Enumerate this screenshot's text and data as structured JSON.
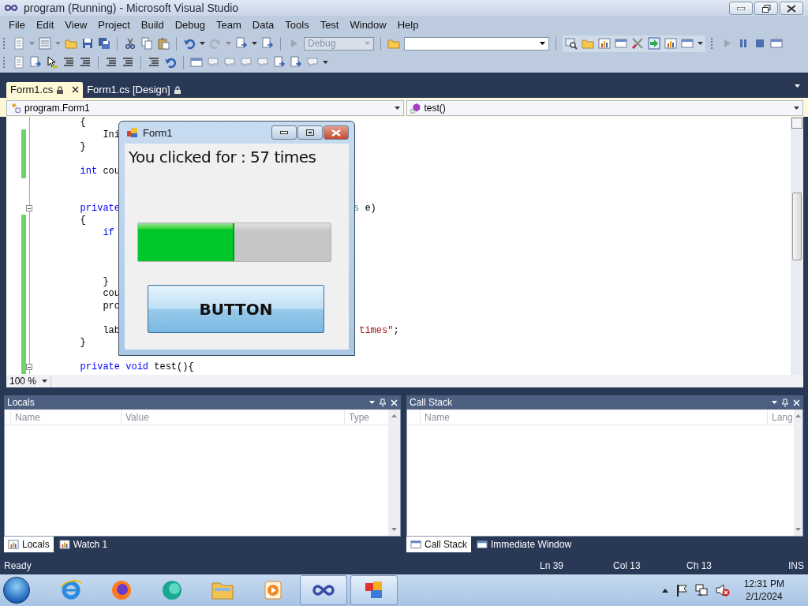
{
  "window": {
    "title": "program (Running) - Microsoft Visual Studio"
  },
  "menu": [
    "File",
    "Edit",
    "View",
    "Project",
    "Build",
    "Debug",
    "Team",
    "Data",
    "Tools",
    "Test",
    "Window",
    "Help"
  ],
  "toolbar": {
    "configuration": {
      "value": "Debug",
      "disabled": true
    }
  },
  "document_tabs": [
    {
      "label": "Form1.cs",
      "selected": true,
      "locked": true
    },
    {
      "label": "Form1.cs [Design]",
      "selected": false,
      "locked": true
    }
  ],
  "navigation": {
    "type_box": "program.Form1",
    "member_box": "test()"
  },
  "editor": {
    "zoom": "100 %",
    "lines": [
      {
        "changed": false,
        "fold": false,
        "segments": [
          {
            "text": "        {",
            "kind": "plain"
          }
        ]
      },
      {
        "changed": true,
        "fold": false,
        "segments": [
          {
            "text": "            Ini",
            "kind": "plain"
          }
        ]
      },
      {
        "changed": true,
        "fold": false,
        "segments": [
          {
            "text": "        }",
            "kind": "plain"
          }
        ]
      },
      {
        "changed": true,
        "fold": false
      },
      {
        "changed": true,
        "fold": false,
        "segments": [
          {
            "text": "        int",
            "kind": "keyword"
          },
          {
            "text": " cou",
            "kind": "plain"
          }
        ]
      },
      {
        "changed": false,
        "fold": false
      },
      {
        "changed": false,
        "fold": false
      },
      {
        "changed": false,
        "fold": true,
        "segments": [
          {
            "text": "        private",
            "kind": "keyword"
          }
        ],
        "right_segments": [
          {
            "text": "s",
            "kind": "type"
          },
          {
            "text": " e)",
            "kind": "plain"
          }
        ]
      },
      {
        "changed": true,
        "fold": false,
        "segments": [
          {
            "text": "        {",
            "kind": "plain"
          }
        ]
      },
      {
        "changed": true,
        "fold": false,
        "segments": [
          {
            "text": "            if",
            "kind": "keyword"
          }
        ]
      },
      {
        "changed": true,
        "fold": false
      },
      {
        "changed": true,
        "fold": false
      },
      {
        "changed": true,
        "fold": false
      },
      {
        "changed": true,
        "fold": false,
        "segments": [
          {
            "text": "            }",
            "kind": "plain"
          }
        ]
      },
      {
        "changed": true,
        "fold": false,
        "segments": [
          {
            "text": "            cou",
            "kind": "plain"
          }
        ]
      },
      {
        "changed": true,
        "fold": false,
        "segments": [
          {
            "text": "            pro",
            "kind": "plain"
          }
        ]
      },
      {
        "changed": true,
        "fold": false
      },
      {
        "changed": true,
        "fold": false,
        "segments": [
          {
            "text": "            lab",
            "kind": "plain"
          }
        ],
        "right_segments": [
          {
            "text": " times\"",
            "kind": "string"
          },
          {
            "text": ";",
            "kind": "plain"
          }
        ]
      },
      {
        "changed": true,
        "fold": false,
        "segments": [
          {
            "text": "        }",
            "kind": "plain"
          }
        ]
      },
      {
        "changed": true,
        "fold": false
      },
      {
        "changed": true,
        "fold": true,
        "segments": [
          {
            "text": "        private",
            "kind": "keyword"
          },
          {
            "text": " void",
            "kind": "keyword"
          },
          {
            "text": " test(){",
            "kind": "plain"
          }
        ]
      }
    ]
  },
  "form_window": {
    "title": "Form1",
    "label": "You clicked for : 57 times",
    "progress": {
      "level": 0.5
    },
    "button": "BUTTON"
  },
  "panels": [
    {
      "title": "Locals",
      "columns": [
        "Name",
        "Value",
        "Type"
      ],
      "tabs": [
        {
          "label": "Locals",
          "selected": true
        },
        {
          "label": "Watch 1",
          "selected": false
        }
      ]
    },
    {
      "title": "Call Stack",
      "columns": [
        "Name",
        "Lang"
      ],
      "tabs": [
        {
          "label": "Call Stack",
          "selected": true
        },
        {
          "label": "Immediate Window",
          "selected": false
        }
      ]
    }
  ],
  "status_bar": {
    "message": "Ready",
    "line": "Ln 39",
    "column": "Col 13",
    "char": "Ch 13",
    "mode": "INS"
  },
  "taskbar": {
    "apps": [
      {
        "kind": "ie",
        "active": false
      },
      {
        "kind": "firefox",
        "active": false
      },
      {
        "kind": "teal",
        "active": false
      },
      {
        "kind": "explorer",
        "active": false
      },
      {
        "kind": "media",
        "active": false
      },
      {
        "kind": "vs",
        "active": true
      },
      {
        "kind": "squares",
        "active": true
      }
    ],
    "clock": {
      "time": "12:31 PM",
      "date": "2/1/2024"
    }
  }
}
